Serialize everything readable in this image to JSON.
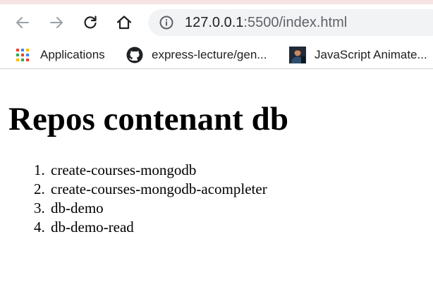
{
  "browser": {
    "nav": {
      "back_icon": "arrow-back-icon",
      "forward_icon": "arrow-forward-icon",
      "reload_icon": "reload-icon",
      "home_icon": "home-icon"
    },
    "address_bar": {
      "host": "127.0.0.1",
      "path": ":5500/index.html",
      "info_icon": "info-icon"
    },
    "bookmarks": [
      {
        "label": "Applications",
        "icon": "apps-grid-icon"
      },
      {
        "label": "express-lecture/gen...",
        "icon": "github-icon"
      },
      {
        "label": "JavaScript Animate...",
        "icon": "avatar-thumbnail-icon"
      }
    ]
  },
  "page": {
    "heading": "Repos contenant db",
    "repos": [
      {
        "num": "1.",
        "name": "create-courses-mongodb"
      },
      {
        "num": "2.",
        "name": "create-courses-mongodb-acompleter"
      },
      {
        "num": "3.",
        "name": "db-demo"
      },
      {
        "num": "4.",
        "name": "db-demo-read"
      }
    ]
  }
}
